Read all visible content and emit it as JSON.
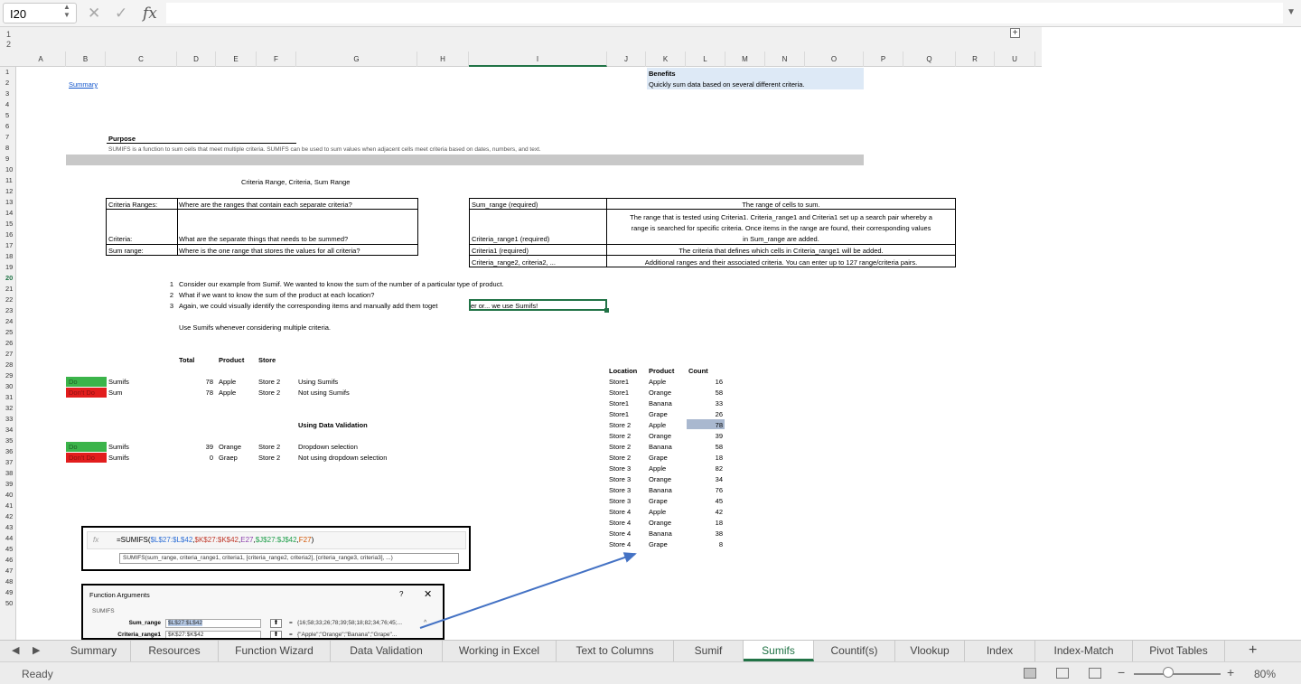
{
  "formula_bar": {
    "name_box": "I20",
    "formula": ""
  },
  "outline": {
    "levels": [
      "1",
      "2"
    ]
  },
  "columns": [
    "A",
    "B",
    "C",
    "D",
    "E",
    "F",
    "G",
    "H",
    "I",
    "J",
    "K",
    "L",
    "M",
    "N",
    "O",
    "P",
    "Q",
    "R",
    "U"
  ],
  "active_column": "I",
  "rows": [
    "1",
    "2",
    "3",
    "4",
    "5",
    "6",
    "7",
    "8",
    "9",
    "10",
    "11",
    "12",
    "13",
    "14",
    "15",
    "16",
    "17",
    "18",
    "19",
    "20",
    "21",
    "22",
    "23",
    "24",
    "25",
    "26",
    "27",
    "28",
    "29",
    "30",
    "31",
    "32",
    "33",
    "34",
    "35",
    "36",
    "37",
    "38",
    "39",
    "40",
    "41",
    "42",
    "43",
    "44",
    "45",
    "46",
    "47",
    "48",
    "49",
    "50"
  ],
  "active_row": "20",
  "sheet": {
    "summary_link": "Summary",
    "benefits_title": "Benefits",
    "benefits_text": "Quickly sum data based on several different criteria.",
    "purpose_title": "Purpose",
    "purpose_text": "SUMIFS is a function to sum cells that meet multiple criteria. SUMIFS can be used to sum values when adjacent cells meet criteria based on dates, numbers, and text.",
    "syntax_heading": "Criteria Range, Criteria, Sum Range",
    "left_table": [
      {
        "label": "Criteria Ranges:",
        "text": "Where are the ranges that contain each separate criteria?"
      },
      {
        "label": "Criteria:",
        "text": "What are  the separate things that needs to be summed?"
      },
      {
        "label": "Sum range:",
        "text": "Where is the one range that stores the values for all criteria?"
      }
    ],
    "args_table": [
      {
        "arg": "Sum_range    (required)",
        "desc_lines": [
          "The range of cells to sum."
        ]
      },
      {
        "arg": "Criteria_range1   (required)",
        "desc_lines": [
          "The range that is tested using Criteria1. Criteria_range1 and Criteria1 set up a search pair whereby a",
          "range is searched for specific criteria. Once items in the range are found, their corresponding values",
          "in Sum_range are added."
        ]
      },
      {
        "arg": "Criteria1   (required)",
        "desc_lines": [
          "The criteria that defines which cells in Criteria_range1 will be added."
        ]
      },
      {
        "arg": "Criteria_range2, criteria2, ...",
        "desc_lines": [
          "Additional ranges and their associated criteria. You can enter up to 127 range/criteria pairs."
        ]
      }
    ],
    "steps": [
      {
        "num": "1",
        "text": "Consider our example from Sumif. We wanted to know the sum of the number of a particular type of product."
      },
      {
        "num": "2",
        "text": "What if we want to know the sum of the product at each location?"
      },
      {
        "num": "3",
        "text": "Again, we could visually identify the corresponding items and manually add them toget"
      }
    ],
    "selected_cell_text": "er or... we use Sumifs!",
    "use_note": "Use Sumifs whenever considering multiple criteria.",
    "example_headers": {
      "total": "Total",
      "product": "Product",
      "store": "Store"
    },
    "examples": [
      {
        "tag": "Do",
        "tag_color": "#3bb44a",
        "func": "Sumifs",
        "total": "78",
        "product": "Apple",
        "store": "Store 2",
        "note": "Using Sumifs"
      },
      {
        "tag": "Don't Do",
        "tag_color": "#e21d1d",
        "func": "Sum",
        "total": "78",
        "product": "Apple",
        "store": "Store 2",
        "note": "Not using Sumifs"
      }
    ],
    "validation_title": "Using Data Validation",
    "validation_examples": [
      {
        "tag": "Do",
        "tag_color": "#3bb44a",
        "func": "Sumifs",
        "total": "39",
        "product": "Orange",
        "store": "Store 2",
        "note": "Dropdown selection"
      },
      {
        "tag": "Don't Do",
        "tag_color": "#e21d1d",
        "func": "Sumifs",
        "total": "0",
        "product": "Graep",
        "store": "Store 2",
        "note": "Not using dropdown selection"
      }
    ],
    "data_headers": {
      "location": "Location",
      "product": "Product",
      "count": "Count"
    },
    "data_rows": [
      [
        "Store1",
        "Apple",
        "16"
      ],
      [
        "Store1",
        "Orange",
        "58"
      ],
      [
        "Store1",
        "Banana",
        "33"
      ],
      [
        "Store1",
        "Grape",
        "26"
      ],
      [
        "Store 2",
        "Apple",
        "78"
      ],
      [
        "Store 2",
        "Orange",
        "39"
      ],
      [
        "Store 2",
        "Banana",
        "58"
      ],
      [
        "Store 2",
        "Grape",
        "18"
      ],
      [
        "Store 3",
        "Apple",
        "82"
      ],
      [
        "Store 3",
        "Orange",
        "34"
      ],
      [
        "Store 3",
        "Banana",
        "76"
      ],
      [
        "Store 3",
        "Grape",
        "45"
      ],
      [
        "Store 4",
        "Apple",
        "42"
      ],
      [
        "Store 4",
        "Orange",
        "18"
      ],
      [
        "Store 4",
        "Banana",
        "38"
      ],
      [
        "Store 4",
        "Grape",
        "8"
      ]
    ]
  },
  "formula_screenshot": {
    "fx": "fx",
    "formula_parts": [
      "=SUMIFS(",
      "$L$27:$L$42",
      ",",
      "$K$27:$K$42",
      ",",
      "E27",
      ",",
      "$J$27:$J$42",
      ",",
      "F27",
      ")"
    ],
    "tooltip": "SUMIFS(sum_range, criteria_range1, criteria1, [criteria_range2, criteria2], [criteria_range3, criteria3], ...)"
  },
  "function_arguments": {
    "title": "Function Arguments",
    "help": "?",
    "close": "✕",
    "function_name": "SUMIFS",
    "fields": [
      {
        "label": "Sum_range",
        "value": "$L$27:$L$42",
        "result": "{16;58;33;26;78;39;58;18;82;34;76;45;..."
      },
      {
        "label": "Criteria_range1",
        "value": "$K$27:$K$42",
        "result": "{\"Apple\";\"Orange\";\"Banana\";\"Grape\"..."
      }
    ]
  },
  "tabs": [
    "Summary",
    "Resources",
    "Function Wizard",
    "Data Validation",
    "Working in Excel",
    "Text to Columns",
    "Sumif",
    "Sumifs",
    "Countif(s)",
    "Vlookup",
    "Index",
    "Index-Match",
    "Pivot Tables"
  ],
  "active_tab": "Sumifs",
  "status": {
    "ready": "Ready",
    "zoom": "80%",
    "zoom_fraction": 0.4
  },
  "colors": {
    "excel_green": "#217346",
    "benefits_bg": "#dde9f6",
    "highlight": "#a9b8cf",
    "arrow": "#4472c4"
  }
}
